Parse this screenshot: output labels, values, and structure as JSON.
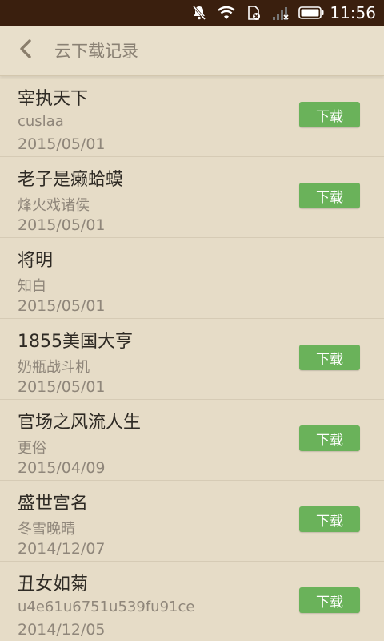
{
  "status_bar": {
    "time": "11:56",
    "icons": [
      "notification-muted-icon",
      "wifi-icon",
      "sim-disabled-icon",
      "signal-icon",
      "battery-icon"
    ]
  },
  "header": {
    "back_icon": "chevron-left-icon",
    "title": "云下载记录"
  },
  "records": [
    {
      "title": "宰执天下",
      "author": "cuslaa",
      "date": "2015/05/01",
      "button": "下载"
    },
    {
      "title": "老子是癞蛤蟆",
      "author": "烽火戏诸侯",
      "date": "2015/05/01",
      "button": "下载"
    },
    {
      "title": "将明",
      "author": "知白",
      "date": "2015/05/01",
      "button": null
    },
    {
      "title": "1855美国大亨",
      "author": "奶瓶战斗机",
      "date": "2015/05/01",
      "button": "下载"
    },
    {
      "title": "官场之风流人生",
      "author": "更俗",
      "date": "2015/04/09",
      "button": "下载"
    },
    {
      "title": "盛世宫名",
      "author": "冬雪晚晴",
      "date": "2014/12/07",
      "button": "下载"
    },
    {
      "title": "丑女如菊",
      "author": "u4e61u6751u539fu91ce",
      "date": "2014/12/05",
      "button": "下载"
    }
  ],
  "colors": {
    "status_bar": "#3a1f0e",
    "background": "#e6dcc7",
    "download_button": "#6ab25a"
  }
}
